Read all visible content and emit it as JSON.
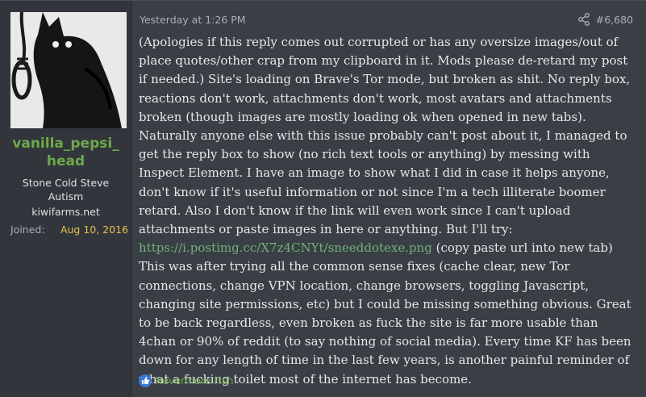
{
  "post": {
    "username": "vanilla_pepsi_head",
    "user_title": "Stone Cold Steve Autism",
    "user_banner": "kiwifarms.net",
    "joined_label": "Joined:",
    "joined_value": "Aug 10, 2016",
    "date": "Yesterday at 1:26 PM",
    "post_number": "#6,680",
    "body_before_link": "(Apologies if this reply comes out corrupted or has any oversize images/out of place quotes/other crap from my clipboard in it. Mods please de-retard my post if needed.) Site's loading on Brave's Tor mode, but broken as shit. No reply box, reactions don't work, attachments don't work, most avatars and attachments broken (though images are mostly loading ok when opened in new tabs). Naturally anyone else with this issue probably can't post about it, I managed to get the reply box to show (no rich text tools or anything) by messing with Inspect Element. I have an image to show what I did in case it helps anyone, don't know if it's useful information or not since I'm a tech illiterate boomer retard. Also I don't know if the link will even work since I can't upload attachments or paste images in here or anything. But I'll try: ",
    "link_text": "https://i.postimg.cc/X7z4CNYt/sneeddotexe.png",
    "body_after_link": " (copy paste url into new tab) This was after trying all the common sense fixes (cache clear, new Tor connections, change VPN location, change browsers, toggling Javascript, changing site permissions, etc) but I could be missing something obvious. Great to be back regardless, even broken as fuck the site is far more usable than 4chan or 90% of reddit (to say nothing of social media). Every time KF has been down for any length of time in the last few years, is another painful reminder of what a fucking toilet most of the internet has become.",
    "reaction_user": "Nevermore Fish"
  },
  "icons": {
    "share": "share-icon",
    "like": "like-icon"
  },
  "colors": {
    "background": "#3a3e45",
    "sidebar": "#32363c",
    "username": "#6ea84a",
    "link": "#6fb07a",
    "joined_date": "#e5c24a",
    "like": "#3a7bd5"
  }
}
